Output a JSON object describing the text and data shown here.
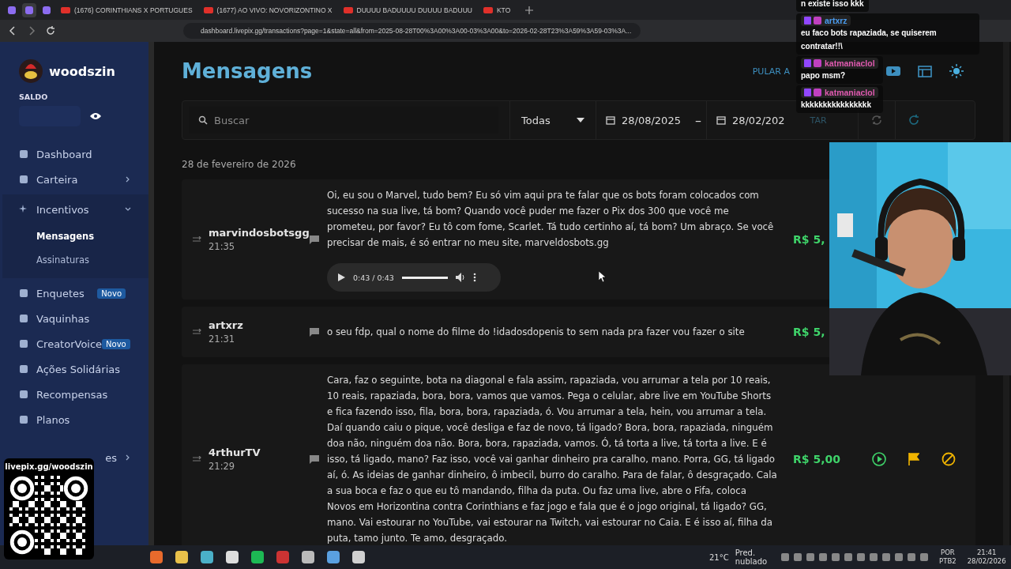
{
  "browser": {
    "tabs": [
      {
        "kind": "icon",
        "selected": false
      },
      {
        "kind": "icon",
        "selected": true
      },
      {
        "kind": "icon",
        "selected": false
      },
      {
        "kind": "page",
        "title": "(1676) CORINTHIANS X PORTUGUES",
        "selected": false
      },
      {
        "kind": "page",
        "title": "(1677) AO VIVO: NOVORIZONTINO X",
        "selected": false
      },
      {
        "kind": "page",
        "title": "DUUUU BADUUUU DUUUU BADUUU",
        "selected": false
      },
      {
        "kind": "page",
        "title": "KTO",
        "selected": false
      }
    ],
    "address": "dashboard.livepix.gg/transactions?page=1&state=all&from=2025-08-28T00%3A00%3A00-03%3A00&to=2026-02-28T23%3A59%3A59-03%3A..."
  },
  "sidebar": {
    "user": "woodszin",
    "balance_label": "SALDO",
    "items": [
      {
        "kind": "item",
        "label": "Dashboard"
      },
      {
        "kind": "item",
        "label": "Carteira",
        "chevron": true
      },
      {
        "kind": "group",
        "label": "Incentivos",
        "expanded": true,
        "children": [
          {
            "label": "Mensagens",
            "selected": true
          },
          {
            "label": "Assinaturas",
            "selected": false
          }
        ]
      },
      {
        "kind": "item",
        "label": "Enquetes",
        "badge": "Novo"
      },
      {
        "kind": "item",
        "label": "Vaquinhas"
      },
      {
        "kind": "item",
        "label": "CreatorVoice",
        "badge": "Novo"
      },
      {
        "kind": "item",
        "label": "Ações Solidárias"
      },
      {
        "kind": "item",
        "label": "Recompensas"
      },
      {
        "kind": "item",
        "label": "Planos"
      },
      {
        "kind": "partial",
        "label": "es",
        "chevron": true
      }
    ]
  },
  "page": {
    "title": "Mensagens",
    "skip_button": "PULAR A",
    "filters": {
      "search": {
        "placeholder": "Buscar"
      },
      "status": "Todas",
      "from": "28/08/2025",
      "separator": "–",
      "to": "28/02/202",
      "action": "TAR"
    },
    "date_heading": "28 de fevereiro de 2026",
    "messages": [
      {
        "user": "marvindosbotsgg",
        "time": "21:35",
        "text": "Oi, eu sou o Marvel, tudo bem? Eu só vim aqui pra te falar que os bots foram colocados com sucesso na sua live, tá bom? Quando você puder me fazer o Pix dos 300 que você me prometeu, por favor? Eu tô com fome, Scarlet. Tá tudo certinho aí, tá bom? Um abraço. Se você precisar de mais, é só entrar no meu site, marveldosbots.gg",
        "audio": {
          "time": "0:43 / 0:43",
          "level": 1
        },
        "amount": "R$ 5,"
      },
      {
        "user": "artxrz",
        "time": "21:31",
        "text": "o seu fdp, qual o nome do filme do !idadosdopenis to sem nada pra fazer vou fazer o site",
        "amount": "R$ 5,"
      },
      {
        "user": "4rthurTV",
        "time": "21:29",
        "text": "Cara, faz o seguinte, bota na diagonal e fala assim, rapaziada, vou arrumar a tela por 10 reais, 10 reais, rapaziada, bora, bora, vamos que vamos. Pega o celular, abre live em YouTube Shorts e fica fazendo isso, fila, bora, bora, rapaziada, ó. Vou arrumar a tela, hein, vou arrumar a tela. Daí quando caiu o pique, você desliga e faz de novo, tá ligado? Bora, bora, rapaziada, ninguém doa não, ninguém doa não. Bora, bora, rapaziada, vamos. Ó, tá torta a live, tá torta a live. E é isso, tá ligado, mano? Faz isso, você vai ganhar dinheiro pra caralho, mano. Porra, GG, tá ligado aí, ó. As ideias de ganhar dinheiro, ô imbecil, burro do caralho. Para de falar, ô desgraçado. Cala a sua boca e faz o que eu tô mandando, filha da puta. Ou faz uma live, abre o Fifa, coloca Novos em Horizontina contra Corinthians e faz jogo e fala que é o jogo original, tá ligado? GG, mano. Vai estourar no YouTube, vai estourar na Twitch, vai estourar no Caia. E é isso aí, filha da puta, tamo junto. Te amo, desgraçado.",
        "amount": "R$ 5,00",
        "actions": true
      }
    ]
  },
  "chat": [
    {
      "text": "n existe isso kkk"
    },
    {
      "user": "artxrz",
      "color": "#4a9cf0",
      "text": "eu faco bots rapaziada, se quiserem contratar!!\\"
    },
    {
      "user": "katmaniaclol",
      "color": "#e05ab0",
      "text": "papo msm?"
    },
    {
      "user": "katmaniaclol",
      "color": "#e05ab0",
      "text": "kkkkkkkkkkkkkkkk"
    }
  ],
  "qr": {
    "label": "livepix.gg/woodszin"
  },
  "taskbar": {
    "weather": "21°C",
    "forecast": "Pred. nublado",
    "lang": "POR",
    "layout": "PTB2",
    "time": "21:41",
    "date": "28/02/2026"
  }
}
